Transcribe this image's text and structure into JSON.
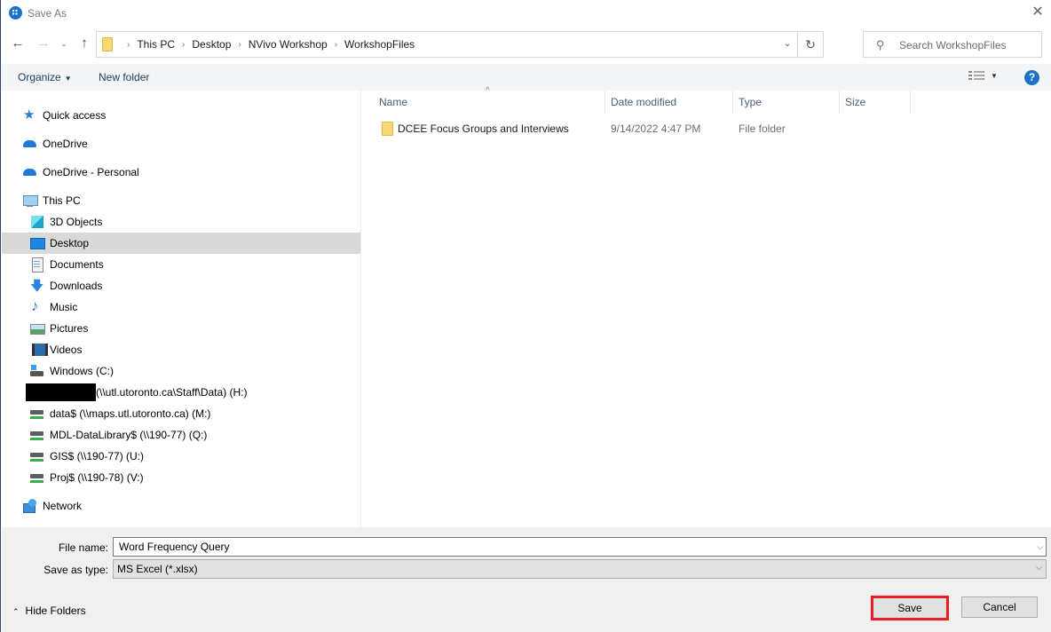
{
  "window": {
    "title": "Save As",
    "close_label": "✕"
  },
  "navigation": {
    "back_icon": "←",
    "forward_icon": "→",
    "recent_icon": "⌄",
    "up_icon": "↑",
    "breadcrumbs": [
      "This PC",
      "Desktop",
      "NVivo Workshop",
      "WorkshopFiles"
    ],
    "crumb_separator": "›",
    "dropdown_icon": "⌄",
    "refresh_icon": "↻",
    "search_placeholder": "Search WorkshopFiles",
    "search_icon": "⚲"
  },
  "toolbar": {
    "organize_label": "Organize",
    "organize_caret": "▼",
    "new_folder_label": "New folder",
    "view_caret": "▼",
    "help_label": "?"
  },
  "sidebar": {
    "items": [
      {
        "label": "Quick access",
        "icon": "star-icon"
      },
      {
        "label": "OneDrive",
        "icon": "cloud-icon"
      },
      {
        "label": "OneDrive - Personal",
        "icon": "cloud-icon"
      },
      {
        "label": "This PC",
        "icon": "computer-icon"
      },
      {
        "label": "3D Objects",
        "icon": "cube-icon"
      },
      {
        "label": "Desktop",
        "icon": "desktop-icon",
        "selected": true
      },
      {
        "label": "Documents",
        "icon": "document-icon"
      },
      {
        "label": "Downloads",
        "icon": "download-arrow-icon"
      },
      {
        "label": "Music",
        "icon": "music-note-icon"
      },
      {
        "label": "Pictures",
        "icon": "picture-icon"
      },
      {
        "label": "Videos",
        "icon": "film-icon"
      },
      {
        "label": "Windows (C:)",
        "icon": "drive-icon"
      },
      {
        "label": "(\\\\utl.utoronto.ca\\Staff\\Data) (H:)",
        "icon": "redacted-block"
      },
      {
        "label": "data$ (\\\\maps.utl.utoronto.ca) (M:)",
        "icon": "network-drive-icon"
      },
      {
        "label": "MDL-DataLibrary$ (\\\\190-77) (Q:)",
        "icon": "network-drive-icon"
      },
      {
        "label": "GIS$ (\\\\190-77) (U:)",
        "icon": "network-drive-icon"
      },
      {
        "label": "Proj$ (\\\\190-78) (V:)",
        "icon": "network-drive-icon"
      },
      {
        "label": "Network",
        "icon": "network-icon"
      }
    ]
  },
  "filelist": {
    "sort_indicator": "^",
    "columns": [
      "Name",
      "Date modified",
      "Type",
      "Size"
    ],
    "rows": [
      {
        "name": "DCEE Focus Groups and Interviews",
        "date_modified": "9/14/2022 4:47 PM",
        "type": "File folder",
        "size": ""
      }
    ]
  },
  "form": {
    "file_name_label": "File name:",
    "file_name_value": "Word Frequency Query",
    "save_as_type_label": "Save as type:",
    "save_as_type_value": "MS Excel (*.xlsx)",
    "dropdown_caret": "⌵"
  },
  "footer": {
    "hide_folders_label": "Hide Folders",
    "hide_folders_icon": "⌃",
    "save_label": "Save",
    "cancel_label": "Cancel",
    "save_highlight_color": "#ed1c24"
  }
}
